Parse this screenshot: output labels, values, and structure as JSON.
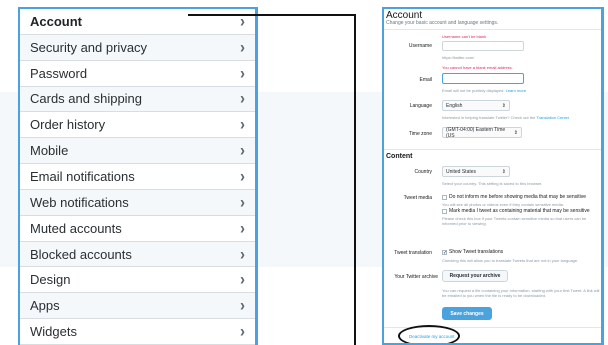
{
  "menu": {
    "items": [
      {
        "label": "Account",
        "active": true
      },
      {
        "label": "Security and privacy",
        "active": false
      },
      {
        "label": "Password",
        "active": false
      },
      {
        "label": "Cards and shipping",
        "active": false
      },
      {
        "label": "Order history",
        "active": false
      },
      {
        "label": "Mobile",
        "active": false
      },
      {
        "label": "Email notifications",
        "active": false
      },
      {
        "label": "Web notifications",
        "active": false
      },
      {
        "label": "Muted accounts",
        "active": false
      },
      {
        "label": "Blocked accounts",
        "active": false
      },
      {
        "label": "Design",
        "active": false
      },
      {
        "label": "Apps",
        "active": false
      },
      {
        "label": "Widgets",
        "active": false
      }
    ],
    "chevron": "›"
  },
  "account": {
    "title": "Account",
    "subtitle": "Change your basic account and language settings.",
    "username": {
      "label": "Username",
      "error": "Username can't be blank",
      "value": "",
      "url": "https://twitter.com/"
    },
    "email": {
      "label": "Email",
      "error": "You cannot have a blank email address.",
      "value": "",
      "note": "Email will not be publicly displayed.",
      "note_link": "Learn more"
    },
    "language": {
      "label": "Language",
      "value": "English",
      "note": "Interested in helping translate Twitter? Check out the",
      "note_link": "Translation Center"
    },
    "timezone": {
      "label": "Time zone",
      "value": "(GMT-04:00) Eastern Time (US"
    }
  },
  "content": {
    "heading": "Content",
    "country": {
      "label": "Country",
      "value": "United States",
      "note": "Select your country. This setting is saved to this browser."
    },
    "tweet_media": {
      "label": "Tweet media",
      "option1": "Do not inform me before showing media that may be sensitive",
      "option1_note": "You will see all photos or videos even if they contain sensitive media.",
      "option2": "Mark media I tweet as containing material that may be sensitive",
      "option2_note": "Please check this box if your Tweets contain sensitive media so that users can be informed prior to viewing."
    },
    "tweet_translation": {
      "label": "Tweet translation",
      "option": "Show Tweet translations",
      "note": "Checking this will allow you to translate Tweets that are not in your language."
    },
    "archive": {
      "label": "Your Twitter archive",
      "button": "Request your archive",
      "note": "You can request a file containing your information, starting with your first Tweet. A link will be emailed to you when the file is ready to be downloaded."
    },
    "save_button": "Save changes",
    "deactivate_link": "Deactivate my account"
  },
  "colors": {
    "accent": "#4aa3df",
    "link": "#1da1f2",
    "error": "#e0245e"
  }
}
